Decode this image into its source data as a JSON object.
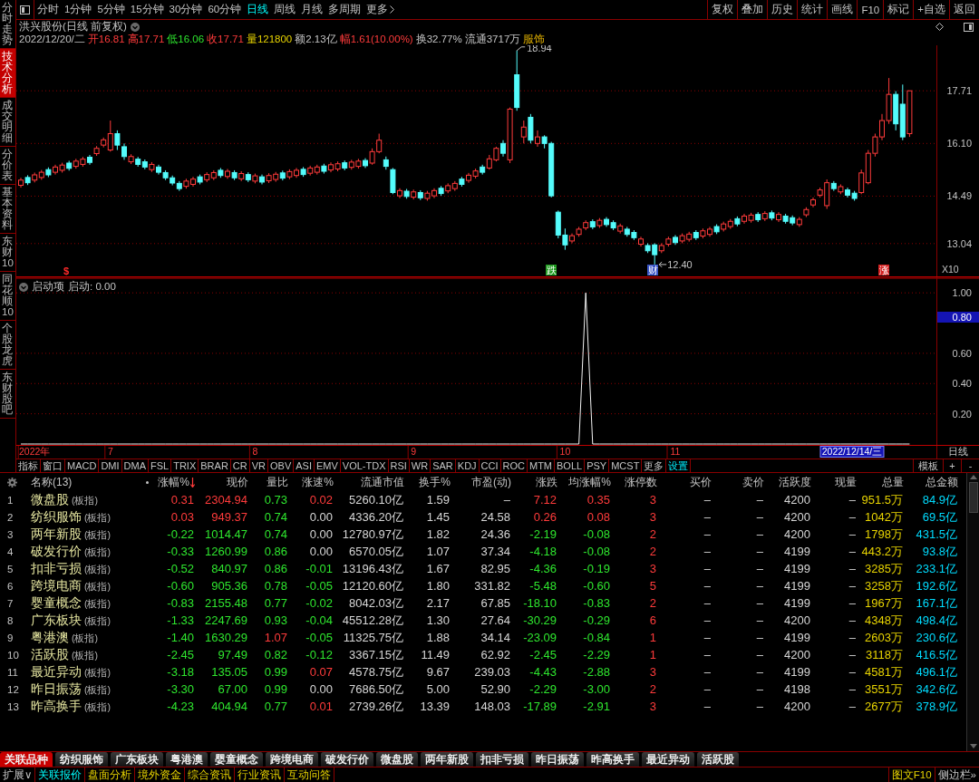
{
  "sidebar": {
    "items": [
      {
        "label": "分时走势",
        "selected": false
      },
      {
        "label": "技术分析",
        "selected": true
      },
      {
        "label": "成交明细",
        "selected": false
      },
      {
        "label": "分价表",
        "selected": false
      },
      {
        "label": "基本资料",
        "selected": false
      },
      {
        "label": "东财10",
        "selected": false
      },
      {
        "label": "同花顺10",
        "selected": false
      },
      {
        "label": "个股龙虎",
        "selected": false
      },
      {
        "label": "东财股吧",
        "selected": false
      }
    ]
  },
  "toolbar": {
    "periods": [
      {
        "label": "分时",
        "selected": false
      },
      {
        "label": "1分钟",
        "selected": false
      },
      {
        "label": "5分钟",
        "selected": false
      },
      {
        "label": "15分钟",
        "selected": false
      },
      {
        "label": "30分钟",
        "selected": false
      },
      {
        "label": "60分钟",
        "selected": false
      },
      {
        "label": "日线",
        "selected": true
      },
      {
        "label": "周线",
        "selected": false
      },
      {
        "label": "月线",
        "selected": false
      },
      {
        "label": "多周期",
        "selected": false
      }
    ],
    "more": "更多",
    "actions": [
      "复权",
      "叠加",
      "历史",
      "统计",
      "画线",
      "F10",
      "标记",
      "+自选",
      "返回"
    ]
  },
  "chart": {
    "title": "洪兴股份(日线 前复权)",
    "quote": [
      {
        "text": "2022/12/20/二",
        "kind": "plain"
      },
      {
        "text": "开16.81",
        "kind": "up"
      },
      {
        "text": "高17.71",
        "kind": "up"
      },
      {
        "text": "低16.06",
        "kind": "down"
      },
      {
        "text": "收17.71",
        "kind": "up"
      },
      {
        "text": "量121800",
        "kind": "volume"
      },
      {
        "text": "额2.13亿",
        "kind": "plain"
      },
      {
        "text": "幅1.61(10.00%)",
        "kind": "up"
      },
      {
        "text": "换32.77%",
        "kind": "plain"
      },
      {
        "text": "流通3717万",
        "kind": "plain"
      },
      {
        "text": "服饰",
        "kind": "sector"
      }
    ],
    "chart_data": {
      "type": "candlestick",
      "categories": [
        null,
        null,
        null,
        null,
        null,
        null,
        null,
        null,
        null,
        null,
        null,
        null,
        null,
        null,
        null,
        null,
        null,
        null,
        null,
        null,
        null,
        null,
        null,
        null,
        null,
        null,
        null,
        null,
        null,
        null,
        null,
        null,
        null,
        null,
        null,
        null,
        null,
        null,
        null,
        null,
        null,
        null,
        null,
        null,
        null,
        null,
        null,
        null,
        null,
        null,
        null,
        null,
        null,
        null,
        null,
        null,
        null,
        null,
        null,
        null,
        null,
        null,
        null,
        null,
        null,
        null,
        null,
        null,
        null,
        null,
        null,
        null,
        null,
        null,
        null,
        null,
        null,
        null,
        null,
        null,
        null,
        null,
        null,
        null,
        null,
        null,
        null,
        null,
        null,
        null,
        null,
        null,
        null,
        null,
        null,
        null,
        null,
        null,
        null,
        null,
        null,
        null,
        null,
        null,
        null,
        null,
        null,
        null,
        null,
        null,
        null,
        null,
        null,
        null,
        null,
        null,
        null,
        null,
        null,
        null,
        null,
        null,
        null,
        null,
        null,
        null,
        null,
        null,
        null,
        null
      ],
      "ohlc": [
        [
          14.82,
          15.05,
          14.75,
          14.98
        ],
        [
          15.06,
          15.13,
          14.83,
          14.9
        ],
        [
          14.98,
          15.21,
          14.91,
          15.14
        ],
        [
          15.06,
          15.29,
          14.99,
          15.22
        ],
        [
          15.3,
          15.37,
          15.07,
          15.14
        ],
        [
          15.22,
          15.45,
          15.15,
          15.38
        ],
        [
          15.28,
          15.51,
          15.21,
          15.44
        ],
        [
          15.5,
          15.57,
          15.27,
          15.34
        ],
        [
          15.4,
          15.63,
          15.33,
          15.56
        ],
        [
          15.46,
          15.69,
          15.39,
          15.62
        ],
        [
          15.68,
          15.75,
          15.45,
          15.52
        ],
        [
          15.79,
          16.02,
          15.72,
          15.95
        ],
        [
          16.05,
          16.28,
          15.98,
          16.21
        ],
        [
          15.9,
          16.8,
          15.85,
          16.4
        ],
        [
          16.4,
          16.5,
          15.9,
          16.05
        ],
        [
          16.0,
          16.1,
          15.6,
          15.7
        ],
        [
          15.54,
          15.77,
          15.47,
          15.7
        ],
        [
          15.62,
          15.69,
          15.39,
          15.46
        ],
        [
          15.54,
          15.61,
          15.31,
          15.38
        ],
        [
          15.3,
          15.53,
          15.23,
          15.46
        ],
        [
          15.38,
          15.45,
          15.15,
          15.22
        ],
        [
          15.21,
          15.28,
          14.98,
          15.05
        ],
        [
          15.05,
          15.12,
          14.82,
          14.89
        ],
        [
          14.88,
          14.95,
          14.65,
          14.72
        ],
        [
          14.79,
          15.02,
          14.72,
          14.95
        ],
        [
          14.85,
          15.08,
          14.78,
          15.01
        ],
        [
          15.08,
          15.15,
          14.85,
          14.92
        ],
        [
          14.99,
          15.22,
          14.92,
          15.15
        ],
        [
          15.05,
          15.28,
          14.98,
          15.21
        ],
        [
          15.28,
          15.35,
          15.05,
          15.12
        ],
        [
          15.09,
          15.32,
          15.02,
          15.25
        ],
        [
          15.21,
          15.28,
          14.98,
          15.05
        ],
        [
          15.02,
          15.25,
          14.95,
          15.18
        ],
        [
          15.15,
          15.22,
          14.92,
          14.99
        ],
        [
          14.95,
          15.18,
          14.88,
          15.11
        ],
        [
          15.08,
          15.15,
          14.85,
          14.92
        ],
        [
          14.96,
          15.19,
          14.89,
          15.12
        ],
        [
          15.0,
          15.23,
          14.93,
          15.16
        ],
        [
          15.2,
          15.27,
          14.97,
          15.04
        ],
        [
          15.08,
          15.31,
          15.01,
          15.24
        ],
        [
          15.12,
          15.35,
          15.05,
          15.28
        ],
        [
          15.31,
          15.38,
          15.08,
          15.15
        ],
        [
          15.19,
          15.42,
          15.12,
          15.35
        ],
        [
          15.22,
          15.45,
          15.15,
          15.38
        ],
        [
          15.41,
          15.48,
          15.18,
          15.25
        ],
        [
          15.29,
          15.52,
          15.22,
          15.45
        ],
        [
          15.32,
          15.55,
          15.25,
          15.48
        ],
        [
          15.51,
          15.58,
          15.28,
          15.35
        ],
        [
          15.37,
          15.6,
          15.3,
          15.53
        ],
        [
          15.4,
          15.63,
          15.33,
          15.56
        ],
        [
          15.58,
          15.65,
          15.35,
          15.42
        ],
        [
          15.5,
          15.95,
          15.45,
          15.85
        ],
        [
          15.85,
          16.4,
          15.8,
          16.2
        ],
        [
          15.6,
          15.7,
          15.3,
          15.4
        ],
        [
          15.3,
          15.35,
          14.55,
          14.6
        ],
        [
          14.5,
          14.73,
          14.43,
          14.66
        ],
        [
          14.64,
          14.71,
          14.41,
          14.48
        ],
        [
          14.46,
          14.69,
          14.39,
          14.62
        ],
        [
          14.6,
          14.67,
          14.37,
          14.44
        ],
        [
          14.42,
          14.65,
          14.35,
          14.58
        ],
        [
          14.5,
          14.73,
          14.43,
          14.66
        ],
        [
          14.73,
          14.8,
          14.5,
          14.57
        ],
        [
          14.65,
          14.88,
          14.58,
          14.81
        ],
        [
          14.72,
          14.95,
          14.65,
          14.88
        ],
        [
          15.01,
          15.08,
          14.78,
          14.85
        ],
        [
          14.97,
          15.2,
          14.9,
          15.13
        ],
        [
          15.1,
          15.33,
          15.03,
          15.26
        ],
        [
          15.38,
          15.45,
          15.15,
          15.22
        ],
        [
          15.35,
          15.75,
          15.3,
          15.63
        ],
        [
          15.6,
          16.0,
          15.55,
          15.95
        ],
        [
          16.1,
          16.2,
          15.7,
          15.8
        ],
        [
          15.6,
          17.2,
          15.5,
          17.15
        ],
        [
          18.2,
          18.94,
          17.1,
          17.2
        ],
        [
          16.3,
          16.8,
          16.1,
          16.6
        ],
        [
          16.9,
          17.0,
          16.1,
          16.2
        ],
        [
          16.1,
          16.5,
          16.0,
          16.3
        ],
        [
          16.3,
          16.35,
          15.95,
          16.1
        ],
        [
          16.1,
          16.15,
          14.45,
          14.5
        ],
        [
          14.0,
          14.05,
          13.2,
          13.3
        ],
        [
          13.3,
          13.5,
          12.85,
          13.0
        ],
        [
          13.12,
          13.35,
          13.05,
          13.28
        ],
        [
          13.32,
          13.55,
          13.25,
          13.48
        ],
        [
          13.52,
          13.75,
          13.45,
          13.68
        ],
        [
          13.71,
          13.78,
          13.48,
          13.55
        ],
        [
          13.59,
          13.82,
          13.52,
          13.75
        ],
        [
          13.78,
          13.85,
          13.55,
          13.62
        ],
        [
          13.68,
          13.75,
          13.45,
          13.52
        ],
        [
          13.42,
          13.65,
          13.35,
          13.58
        ],
        [
          13.48,
          13.55,
          13.25,
          13.32
        ],
        [
          13.38,
          13.45,
          13.15,
          13.22
        ],
        [
          13.02,
          13.25,
          12.95,
          13.18
        ],
        [
          12.98,
          13.05,
          12.75,
          12.82
        ],
        [
          13.0,
          13.05,
          12.4,
          12.7
        ],
        [
          12.82,
          13.05,
          12.75,
          12.98
        ],
        [
          13.02,
          13.25,
          12.95,
          13.18
        ],
        [
          13.23,
          13.3,
          13.0,
          13.07
        ],
        [
          13.12,
          13.35,
          13.05,
          13.28
        ],
        [
          13.17,
          13.4,
          13.1,
          13.33
        ],
        [
          13.38,
          13.45,
          13.15,
          13.22
        ],
        [
          13.27,
          13.5,
          13.2,
          13.43
        ],
        [
          13.32,
          13.55,
          13.25,
          13.48
        ],
        [
          13.56,
          13.63,
          13.33,
          13.4
        ],
        [
          13.48,
          13.71,
          13.41,
          13.64
        ],
        [
          13.56,
          13.79,
          13.49,
          13.72
        ],
        [
          13.8,
          13.87,
          13.57,
          13.64
        ],
        [
          13.72,
          13.95,
          13.65,
          13.88
        ],
        [
          13.75,
          13.98,
          13.68,
          13.91
        ],
        [
          13.93,
          14.0,
          13.7,
          13.77
        ],
        [
          13.8,
          14.03,
          13.73,
          13.96
        ],
        [
          13.98,
          14.05,
          13.75,
          13.82
        ],
        [
          13.77,
          14.0,
          13.7,
          13.93
        ],
        [
          13.88,
          13.95,
          13.65,
          13.72
        ],
        [
          13.83,
          13.9,
          13.6,
          13.67
        ],
        [
          13.62,
          13.85,
          13.55,
          13.78
        ],
        [
          13.92,
          14.15,
          13.85,
          14.08
        ],
        [
          14.22,
          14.45,
          14.15,
          14.38
        ],
        [
          14.52,
          14.75,
          14.45,
          14.68
        ],
        [
          14.2,
          15.0,
          14.1,
          14.9
        ],
        [
          14.88,
          14.95,
          14.65,
          14.72
        ],
        [
          14.62,
          14.85,
          14.55,
          14.78
        ],
        [
          14.68,
          14.75,
          14.45,
          14.52
        ],
        [
          14.58,
          14.65,
          14.35,
          14.42
        ],
        [
          14.6,
          15.3,
          14.55,
          15.2
        ],
        [
          14.9,
          15.9,
          14.85,
          15.8
        ],
        [
          15.8,
          16.4,
          15.7,
          16.3
        ],
        [
          16.3,
          17.0,
          16.2,
          16.8
        ],
        [
          16.8,
          18.1,
          16.7,
          17.6
        ],
        [
          17.6,
          17.7,
          16.5,
          16.7
        ],
        [
          17.3,
          17.9,
          16.2,
          16.3
        ],
        [
          16.4,
          17.71,
          16.3,
          17.71
        ]
      ],
      "ylim": [
        12.01,
        19.1
      ],
      "yticks": [
        {
          "value": 17.71,
          "label": "17.71"
        },
        {
          "value": 16.1,
          "label": "16.10"
        },
        {
          "value": 14.49,
          "label": "14.49"
        },
        {
          "value": 13.04,
          "label": "13.04"
        }
      ],
      "grid": true
    },
    "high_label": "18.94",
    "low_label": "12.40",
    "markers": [
      {
        "text": "$",
        "kind": "sign",
        "color": "#ff2a2a"
      },
      {
        "text": "跌",
        "kind": "badge",
        "color": "#1f9a1f"
      },
      {
        "text": "财",
        "kind": "badge",
        "color": "#3a56c8"
      },
      {
        "text": "涨",
        "kind": "badge",
        "color": "#d42020"
      }
    ],
    "scale": "X10"
  },
  "indicator": {
    "name": "启动项",
    "reading": "启动: 0.00",
    "cursor_label": "0.80",
    "chart_data": {
      "type": "line",
      "categories": [
        null,
        null,
        "2022年",
        null,
        null,
        null,
        null,
        null,
        null,
        null,
        null,
        null,
        null,
        "7",
        null,
        null,
        null,
        null,
        null,
        null,
        null,
        null,
        null,
        null,
        null,
        null,
        null,
        null,
        null,
        null,
        null,
        null,
        null,
        null,
        "8",
        null,
        null,
        null,
        null,
        null,
        null,
        null,
        null,
        null,
        null,
        null,
        null,
        null,
        null,
        null,
        null,
        null,
        null,
        null,
        null,
        null,
        null,
        "9",
        null,
        null,
        null,
        null,
        null,
        null,
        null,
        null,
        null,
        null,
        null,
        null,
        null,
        null,
        null,
        null,
        null,
        null,
        null,
        null,
        null,
        "10",
        null,
        null,
        null,
        null,
        null,
        null,
        null,
        null,
        null,
        null,
        null,
        null,
        null,
        null,
        null,
        "11",
        null,
        null,
        null,
        null,
        null,
        null,
        null,
        null,
        null,
        null,
        null,
        null,
        null,
        null,
        null,
        null,
        null,
        null,
        null,
        null,
        null,
        null,
        null,
        null,
        null,
        null,
        null,
        null,
        null,
        null,
        null,
        null,
        null,
        null
      ],
      "values": [
        0,
        0,
        0,
        0,
        0,
        0,
        0,
        0,
        0,
        0,
        0,
        0,
        0,
        0,
        0,
        0,
        0,
        0,
        0,
        0,
        0,
        0,
        0,
        0,
        0,
        0,
        0,
        0,
        0,
        0,
        0,
        0,
        0,
        0,
        0,
        0,
        0,
        0,
        0,
        0,
        0,
        0,
        0,
        0,
        0,
        0,
        0,
        0,
        0,
        0,
        0,
        0,
        0,
        0,
        0,
        0,
        0,
        0,
        0,
        0,
        0,
        0,
        0,
        0,
        0,
        0,
        0,
        0,
        0,
        0,
        0,
        0,
        0,
        0,
        0,
        0,
        0,
        0,
        0,
        0,
        0,
        0,
        1,
        0,
        0,
        0,
        0,
        0,
        0,
        0,
        0,
        0,
        0,
        0,
        0,
        0,
        0,
        0,
        0,
        0,
        0,
        0,
        0,
        0,
        0,
        0,
        0,
        0,
        0,
        0,
        0,
        0,
        0,
        0,
        0,
        0,
        0,
        0,
        0,
        0,
        0,
        0,
        0,
        0,
        0,
        0,
        0,
        0,
        0,
        0
      ],
      "ylim": [
        0,
        1.1
      ],
      "yticks": [
        {
          "value": 0.2,
          "label": "0.20"
        },
        {
          "value": 0.4,
          "label": "0.40"
        },
        {
          "value": 0.6,
          "label": "0.60"
        },
        {
          "value": 1,
          "label": "1.00"
        }
      ],
      "grid": true
    }
  },
  "time_axis": {
    "cursor_date": "2022/12/14/三",
    "period": "日线"
  },
  "indicator_tabs": {
    "items": [
      {
        "label": "指标",
        "kind": "tab"
      },
      {
        "label": "窗口",
        "kind": "tab"
      },
      {
        "label": "MACD",
        "kind": "tab"
      },
      {
        "label": "DMI",
        "kind": "tab"
      },
      {
        "label": "DMA",
        "kind": "tab"
      },
      {
        "label": "FSL",
        "kind": "tab"
      },
      {
        "label": "TRIX",
        "kind": "tab"
      },
      {
        "label": "BRAR",
        "kind": "tab"
      },
      {
        "label": "CR",
        "kind": "tab"
      },
      {
        "label": "VR",
        "kind": "tab"
      },
      {
        "label": "OBV",
        "kind": "tab"
      },
      {
        "label": "ASI",
        "kind": "tab"
      },
      {
        "label": "EMV",
        "kind": "tab"
      },
      {
        "label": "VOL-TDX",
        "kind": "tab"
      },
      {
        "label": "RSI",
        "kind": "tab"
      },
      {
        "label": "WR",
        "kind": "tab"
      },
      {
        "label": "SAR",
        "kind": "tab"
      },
      {
        "label": "KDJ",
        "kind": "tab"
      },
      {
        "label": "CCI",
        "kind": "tab"
      },
      {
        "label": "ROC",
        "kind": "tab"
      },
      {
        "label": "MTM",
        "kind": "tab"
      },
      {
        "label": "BOLL",
        "kind": "tab"
      },
      {
        "label": "PSY",
        "kind": "tab"
      },
      {
        "label": "MCST",
        "kind": "tab"
      },
      {
        "label": "更多",
        "kind": "tab"
      },
      {
        "label": "设置",
        "kind": "action"
      }
    ],
    "template": "模板",
    "add": "+",
    "remove": "-"
  },
  "table": {
    "columns": [
      {
        "label": "名称(13)",
        "sorted": false
      },
      {
        "label": "涨幅%",
        "sorted": true
      },
      {
        "label": "现价",
        "sorted": false
      },
      {
        "label": "量比",
        "sorted": false
      },
      {
        "label": "涨速%",
        "sorted": false
      },
      {
        "label": "流通市值",
        "sorted": false
      },
      {
        "label": "换手%",
        "sorted": false
      },
      {
        "label": "市盈(动)",
        "sorted": false
      },
      {
        "label": "涨跌",
        "sorted": false
      },
      {
        "label": "均涨幅%",
        "sorted": false
      },
      {
        "label": "涨停数",
        "sorted": false
      },
      {
        "label": "买价",
        "sorted": false
      },
      {
        "label": "卖价",
        "sorted": false
      },
      {
        "label": "活跃度",
        "sorted": false
      },
      {
        "label": "现量",
        "sorted": false
      },
      {
        "label": "总量",
        "sorted": false
      },
      {
        "label": "总金额",
        "sorted": false
      }
    ],
    "rows": [
      {
        "no": "1",
        "name": "微盘股",
        "tag": "(板指)",
        "rising": true,
        "ratio_rising": false,
        "speed_rising": true,
        "speed_falling": false,
        "change_pct": "0.31",
        "price": "2304.94",
        "volume_ratio": "0.73",
        "speed": "0.02",
        "float_cap": "5260.10亿",
        "turnover": "1.59",
        "pe": "–",
        "change": "7.12",
        "avg_change": "0.35",
        "limit_up": "3",
        "bid": "–",
        "ask": "–",
        "activity": "4200",
        "last_vol": "–",
        "volume": "951.5万",
        "amount": "84.9亿"
      },
      {
        "no": "2",
        "name": "纺织服饰",
        "tag": "(板指)",
        "rising": true,
        "ratio_rising": false,
        "speed_rising": false,
        "speed_falling": false,
        "change_pct": "0.03",
        "price": "949.37",
        "volume_ratio": "0.74",
        "speed": "0.00",
        "float_cap": "4336.20亿",
        "turnover": "1.45",
        "pe": "24.58",
        "change": "0.26",
        "avg_change": "0.08",
        "limit_up": "3",
        "bid": "–",
        "ask": "–",
        "activity": "4200",
        "last_vol": "–",
        "volume": "1042万",
        "amount": "69.5亿"
      },
      {
        "no": "3",
        "name": "两年新股",
        "tag": "(板指)",
        "rising": false,
        "ratio_rising": false,
        "speed_rising": false,
        "speed_falling": false,
        "change_pct": "-0.22",
        "price": "1014.47",
        "volume_ratio": "0.74",
        "speed": "0.00",
        "float_cap": "12780.97亿",
        "turnover": "1.82",
        "pe": "24.36",
        "change": "-2.19",
        "avg_change": "-0.08",
        "limit_up": "2",
        "bid": "–",
        "ask": "–",
        "activity": "4200",
        "last_vol": "–",
        "volume": "1798万",
        "amount": "431.5亿"
      },
      {
        "no": "4",
        "name": "破发行价",
        "tag": "(板指)",
        "rising": false,
        "ratio_rising": false,
        "speed_rising": false,
        "speed_falling": false,
        "change_pct": "-0.33",
        "price": "1260.99",
        "volume_ratio": "0.86",
        "speed": "0.00",
        "float_cap": "6570.05亿",
        "turnover": "1.07",
        "pe": "37.34",
        "change": "-4.18",
        "avg_change": "-0.08",
        "limit_up": "2",
        "bid": "–",
        "ask": "–",
        "activity": "4199",
        "last_vol": "–",
        "volume": "443.2万",
        "amount": "93.8亿"
      },
      {
        "no": "5",
        "name": "扣非亏损",
        "tag": "(板指)",
        "rising": false,
        "ratio_rising": false,
        "speed_rising": false,
        "speed_falling": true,
        "change_pct": "-0.52",
        "price": "840.97",
        "volume_ratio": "0.86",
        "speed": "-0.01",
        "float_cap": "13196.43亿",
        "turnover": "1.67",
        "pe": "82.95",
        "change": "-4.36",
        "avg_change": "-0.19",
        "limit_up": "3",
        "bid": "–",
        "ask": "–",
        "activity": "4199",
        "last_vol": "–",
        "volume": "3285万",
        "amount": "233.1亿"
      },
      {
        "no": "6",
        "name": "跨境电商",
        "tag": "(板指)",
        "rising": false,
        "ratio_rising": false,
        "speed_rising": false,
        "speed_falling": true,
        "change_pct": "-0.60",
        "price": "905.36",
        "volume_ratio": "0.78",
        "speed": "-0.05",
        "float_cap": "12120.60亿",
        "turnover": "1.80",
        "pe": "331.82",
        "change": "-5.48",
        "avg_change": "-0.60",
        "limit_up": "5",
        "bid": "–",
        "ask": "–",
        "activity": "4199",
        "last_vol": "–",
        "volume": "3258万",
        "amount": "192.6亿"
      },
      {
        "no": "7",
        "name": "婴童概念",
        "tag": "(板指)",
        "rising": false,
        "ratio_rising": false,
        "speed_rising": false,
        "speed_falling": true,
        "change_pct": "-0.83",
        "price": "2155.48",
        "volume_ratio": "0.77",
        "speed": "-0.02",
        "float_cap": "8042.03亿",
        "turnover": "2.17",
        "pe": "67.85",
        "change": "-18.10",
        "avg_change": "-0.83",
        "limit_up": "2",
        "bid": "–",
        "ask": "–",
        "activity": "4199",
        "last_vol": "–",
        "volume": "1967万",
        "amount": "167.1亿"
      },
      {
        "no": "8",
        "name": "广东板块",
        "tag": "(板指)",
        "rising": false,
        "ratio_rising": false,
        "speed_rising": false,
        "speed_falling": true,
        "change_pct": "-1.33",
        "price": "2247.69",
        "volume_ratio": "0.93",
        "speed": "-0.04",
        "float_cap": "45512.28亿",
        "turnover": "1.30",
        "pe": "27.64",
        "change": "-30.29",
        "avg_change": "-0.29",
        "limit_up": "6",
        "bid": "–",
        "ask": "–",
        "activity": "4200",
        "last_vol": "–",
        "volume": "4348万",
        "amount": "498.4亿"
      },
      {
        "no": "9",
        "name": "粤港澳",
        "tag": "(板指)",
        "rising": false,
        "ratio_rising": true,
        "speed_rising": false,
        "speed_falling": true,
        "change_pct": "-1.40",
        "price": "1630.29",
        "volume_ratio": "1.07",
        "speed": "-0.05",
        "float_cap": "11325.75亿",
        "turnover": "1.88",
        "pe": "34.14",
        "change": "-23.09",
        "avg_change": "-0.84",
        "limit_up": "1",
        "bid": "–",
        "ask": "–",
        "activity": "4199",
        "last_vol": "–",
        "volume": "2603万",
        "amount": "230.6亿"
      },
      {
        "no": "10",
        "name": "活跃股",
        "tag": "(板指)",
        "rising": false,
        "ratio_rising": false,
        "speed_rising": false,
        "speed_falling": true,
        "change_pct": "-2.45",
        "price": "97.49",
        "volume_ratio": "0.82",
        "speed": "-0.12",
        "float_cap": "3367.15亿",
        "turnover": "11.49",
        "pe": "62.92",
        "change": "-2.45",
        "avg_change": "-2.29",
        "limit_up": "1",
        "bid": "–",
        "ask": "–",
        "activity": "4200",
        "last_vol": "–",
        "volume": "3118万",
        "amount": "416.5亿"
      },
      {
        "no": "11",
        "name": "最近异动",
        "tag": "(板指)",
        "rising": false,
        "ratio_rising": false,
        "speed_rising": true,
        "speed_falling": false,
        "change_pct": "-3.18",
        "price": "135.05",
        "volume_ratio": "0.99",
        "speed": "0.07",
        "float_cap": "4578.75亿",
        "turnover": "9.67",
        "pe": "239.03",
        "change": "-4.43",
        "avg_change": "-2.88",
        "limit_up": "3",
        "bid": "–",
        "ask": "–",
        "activity": "4199",
        "last_vol": "–",
        "volume": "4581万",
        "amount": "496.1亿"
      },
      {
        "no": "12",
        "name": "昨日振荡",
        "tag": "(板指)",
        "rising": false,
        "ratio_rising": false,
        "speed_rising": false,
        "speed_falling": false,
        "change_pct": "-3.30",
        "price": "67.00",
        "volume_ratio": "0.99",
        "speed": "0.00",
        "float_cap": "7686.50亿",
        "turnover": "5.00",
        "pe": "52.90",
        "change": "-2.29",
        "avg_change": "-3.00",
        "limit_up": "2",
        "bid": "–",
        "ask": "–",
        "activity": "4198",
        "last_vol": "–",
        "volume": "3551万",
        "amount": "342.6亿"
      },
      {
        "no": "13",
        "name": "昨高换手",
        "tag": "(板指)",
        "rising": false,
        "ratio_rising": false,
        "speed_rising": true,
        "speed_falling": false,
        "change_pct": "-4.23",
        "price": "404.94",
        "volume_ratio": "0.77",
        "speed": "0.01",
        "float_cap": "2739.26亿",
        "turnover": "13.39",
        "pe": "148.03",
        "change": "-17.89",
        "avg_change": "-2.91",
        "limit_up": "3",
        "bid": "–",
        "ask": "–",
        "activity": "4200",
        "last_vol": "–",
        "volume": "2677万",
        "amount": "378.9亿"
      }
    ]
  },
  "related_tabs": [
    {
      "label": "关联品种",
      "selected": true
    },
    {
      "label": "纺织服饰",
      "selected": false
    },
    {
      "label": "广东板块",
      "selected": false
    },
    {
      "label": "粤港澳",
      "selected": false
    },
    {
      "label": "婴童概念",
      "selected": false
    },
    {
      "label": "跨境电商",
      "selected": false
    },
    {
      "label": "破发行价",
      "selected": false
    },
    {
      "label": "微盘股",
      "selected": false
    },
    {
      "label": "两年新股",
      "selected": false
    },
    {
      "label": "扣非亏损",
      "selected": false
    },
    {
      "label": "昨日振荡",
      "selected": false
    },
    {
      "label": "昨高换手",
      "selected": false
    },
    {
      "label": "最近异动",
      "selected": false
    },
    {
      "label": "活跃股",
      "selected": false
    }
  ],
  "status_bar": {
    "expand": "扩展∨",
    "links": [
      {
        "label": "关联报价",
        "selected": true
      },
      {
        "label": "盘面分析",
        "selected": false
      },
      {
        "label": "境外资金",
        "selected": false
      },
      {
        "label": "综合资讯",
        "selected": false
      },
      {
        "label": "行业资讯",
        "selected": false
      },
      {
        "label": "互动问答",
        "selected": false
      }
    ],
    "right": [
      {
        "label": "图文F10",
        "kind": "link"
      },
      {
        "label": "侧边栏»",
        "kind": "menu"
      }
    ]
  }
}
